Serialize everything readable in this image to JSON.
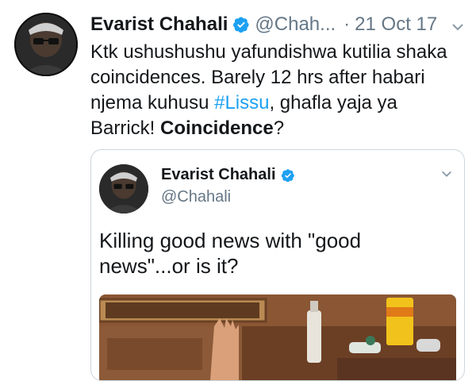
{
  "tweet": {
    "author_name": "Evarist Chahali",
    "handle": "@Chah...",
    "separator": "·",
    "date": "21 Oct 17",
    "text_part1": "Ktk ushushushu yafundishwa kutilia shaka coincidences. Barely 12 hrs after habari njema kuhusu ",
    "hashtag": "#Lissu",
    "text_part2": ", ghafla yaja ya Barrick! ",
    "text_bold": "Coincidence",
    "text_end": "?"
  },
  "quoted_tweet": {
    "author_name": "Evarist Chahali",
    "handle": "@Chahali",
    "text": "Killing good news with \"good news\"...or is it?"
  },
  "colors": {
    "accent": "#1da1f2",
    "muted": "#657786",
    "text": "#14171a",
    "border": "#ccd6dd"
  },
  "icons": [
    "verified-badge-icon",
    "chevron-down-icon"
  ]
}
